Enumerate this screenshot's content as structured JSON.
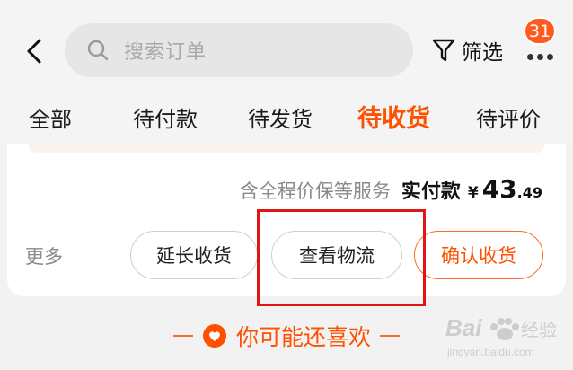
{
  "header": {
    "search_placeholder": "搜索订单",
    "filter_label": "筛选",
    "more_badge": "31",
    "icons": {
      "back": "chevron-left-icon",
      "search": "search-icon",
      "filter": "filter-funnel-icon",
      "more": "more-dots-icon"
    }
  },
  "tabs": [
    {
      "label": "全部"
    },
    {
      "label": "待付款"
    },
    {
      "label": "待发货"
    },
    {
      "label": "待收货",
      "active": true
    },
    {
      "label": "待评价"
    }
  ],
  "order": {
    "service_text": "含全程价保等服务",
    "pay_label": "实付款",
    "currency": "¥",
    "amount_int": "43",
    "amount_dec": ".49",
    "more_label": "更多",
    "buttons": {
      "extend": "延长收货",
      "logistics": "查看物流",
      "confirm": "确认收货"
    }
  },
  "recommend": {
    "title": "你可能还喜欢",
    "icon": "heart-icon"
  },
  "watermark": {
    "brand": "Baidu经验",
    "url": "jingyan.baidu.com"
  },
  "colors": {
    "accent": "#ff5000",
    "highlight": "#e01515",
    "badge": "#ff5a1f"
  }
}
